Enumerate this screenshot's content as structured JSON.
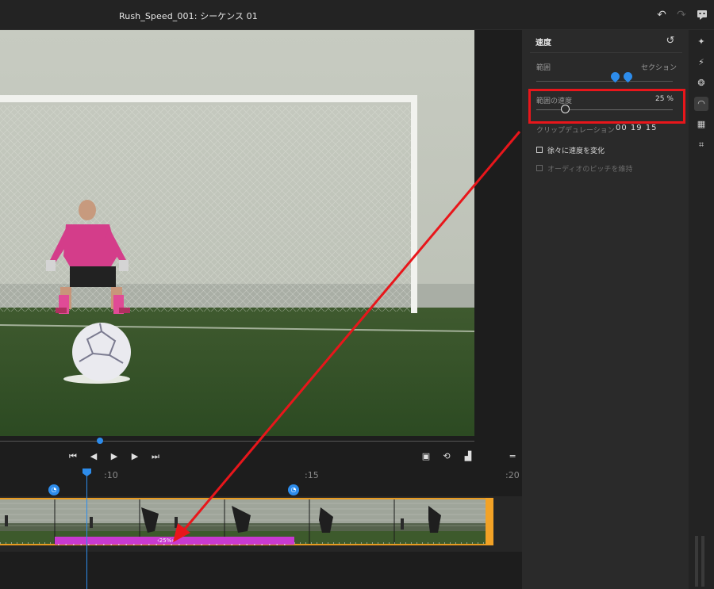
{
  "window": {
    "title": "Rush_Speed_001: シーケンス 01"
  },
  "top_icons": {
    "undo": "undo-icon",
    "redo": "redo-icon",
    "comment": "comment-icon"
  },
  "timeline": {
    "ruler_marks": [
      ":10",
      ":15",
      ":20"
    ],
    "speed_label": "‹25%›",
    "colors": {
      "clip_border": "#e79a20",
      "speed_bar": "#c93ad0",
      "playhead": "#2d8ceb"
    }
  },
  "panel": {
    "title": "速度",
    "range_label": "範囲",
    "range_value": "セクション",
    "speed_label": "範囲の速度",
    "speed_value": "25 %",
    "duration_label": "クリップデュレーション",
    "duration_value": "00  19  15",
    "checkbox_ramp": "徐々に速度を変化",
    "checkbox_pitch": "オーディオのピッチを維持"
  },
  "annotation": {
    "highlight_color": "#e8161b",
    "arrow_color": "#e8161b"
  }
}
